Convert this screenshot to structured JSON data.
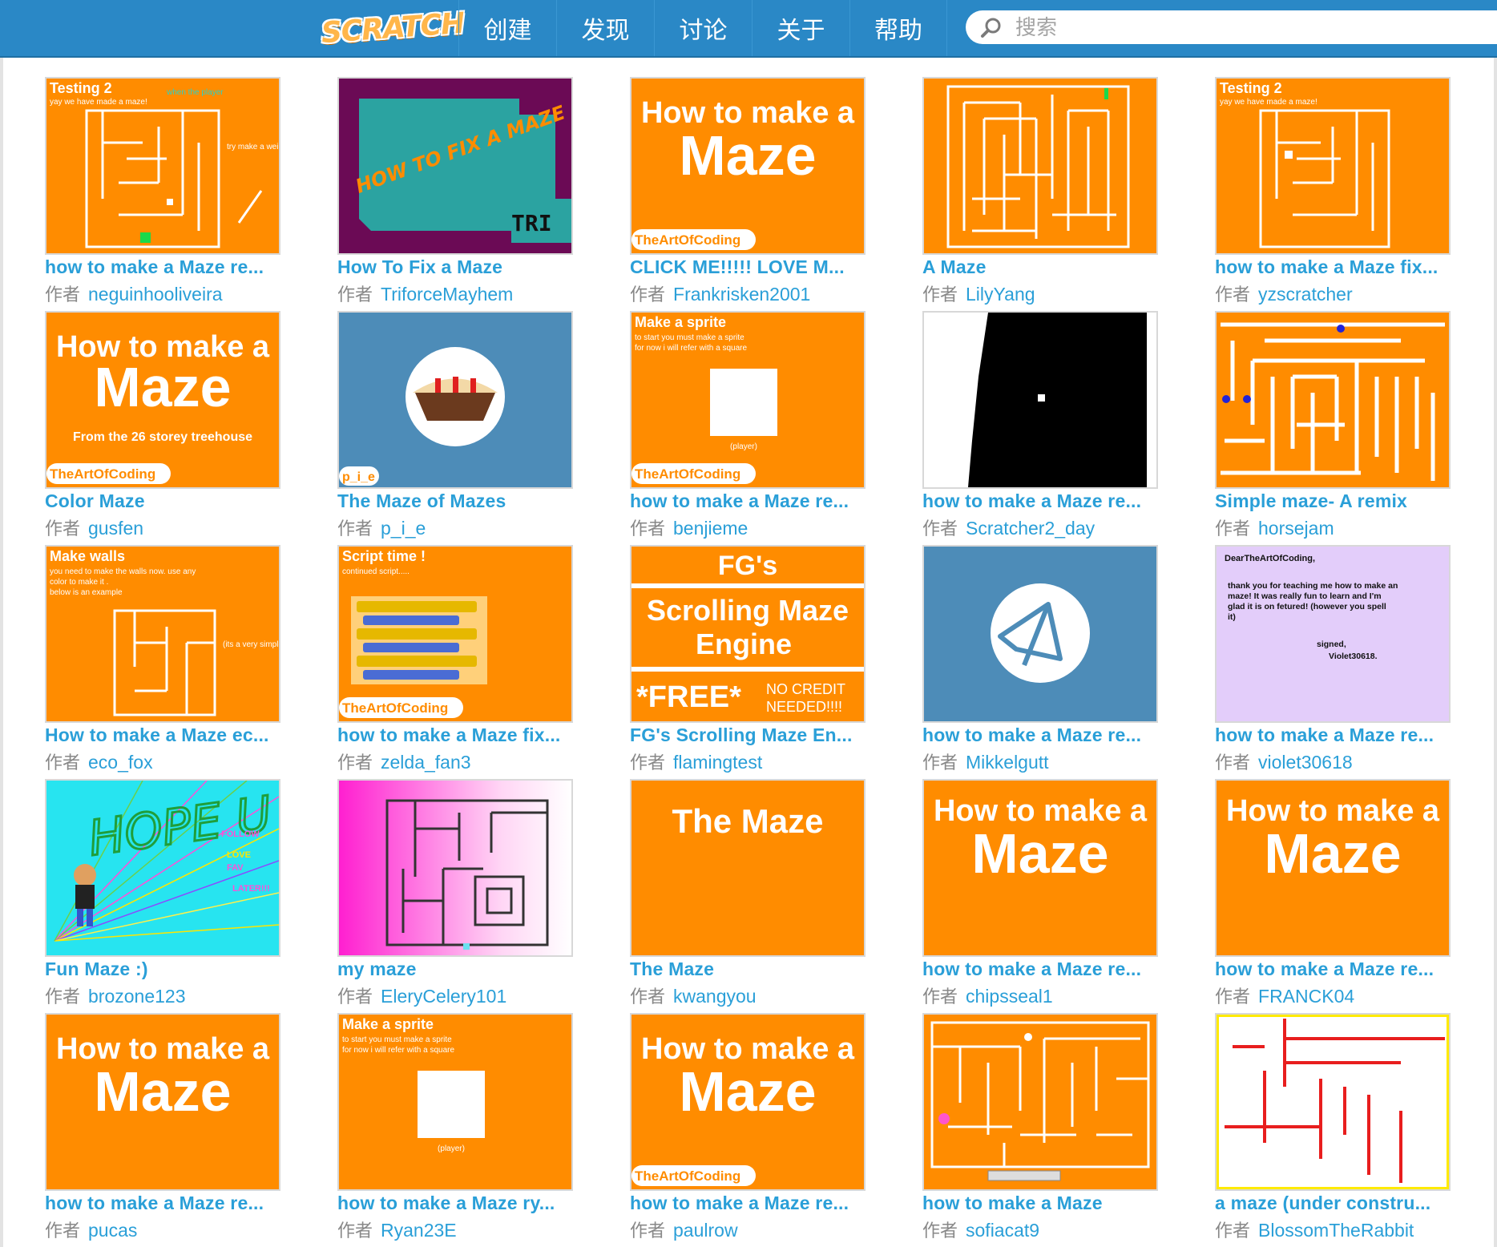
{
  "header": {
    "logo": "SCRATCH",
    "nav": [
      "创建",
      "发现",
      "讨论",
      "关于",
      "帮助"
    ],
    "search_placeholder": "搜索"
  },
  "by_label": "作者",
  "colors": {
    "nav_bg": "#2a88c6",
    "link": "#2a9fd8",
    "thumb_orange": "#ff8c00"
  },
  "projects": [
    {
      "title": "how to make a Maze re...",
      "author": "neguinhooliveira"
    },
    {
      "title": "How To Fix a Maze",
      "author": "TriforceMayhem"
    },
    {
      "title": "CLICK ME!!!!! LOVE M...",
      "author": "Frankrisken2001"
    },
    {
      "title": "A Maze",
      "author": "LilyYang"
    },
    {
      "title": "how to make a Maze fix...",
      "author": "yzscratcher"
    },
    {
      "title": "Color Maze",
      "author": "gusfen"
    },
    {
      "title": "The Maze of Mazes",
      "author": "p_i_e"
    },
    {
      "title": "how to make a Maze re...",
      "author": "benjieme"
    },
    {
      "title": "how to make a Maze re...",
      "author": "Scratcher2_day"
    },
    {
      "title": "Simple maze- A remix",
      "author": "horsejam"
    },
    {
      "title": "How to make a Maze ec...",
      "author": "eco_fox"
    },
    {
      "title": "how to make a Maze fix...",
      "author": "zelda_fan3"
    },
    {
      "title": "FG's Scrolling Maze En...",
      "author": "flamingtest"
    },
    {
      "title": "how to make a Maze re...",
      "author": "Mikkelgutt"
    },
    {
      "title": "how to make a Maze re...",
      "author": "violet30618"
    },
    {
      "title": "Fun Maze :)",
      "author": "brozone123"
    },
    {
      "title": "my maze",
      "author": "EleryCelery101"
    },
    {
      "title": "The Maze",
      "author": "kwangyou"
    },
    {
      "title": "how to make a Maze re...",
      "author": "chipsseal1"
    },
    {
      "title": "how to make a Maze re...",
      "author": "FRANCK04"
    },
    {
      "title": "how to make a Maze re...",
      "author": "pucas"
    },
    {
      "title": "how to make a Maze ry...",
      "author": "Ryan23E"
    },
    {
      "title": "how to make a Maze re...",
      "author": "paulrow"
    },
    {
      "title": "how to make a Maze",
      "author": "sofiacat9"
    },
    {
      "title": "a maze (under constru...",
      "author": "BlossomTheRabbit"
    }
  ],
  "thumb_text": {
    "testing2": "Testing 2",
    "yay": "yay we have made a maze!",
    "when_player": "when the player",
    "try_weirdy": "try make a weirdy",
    "howto1": "How to make a",
    "howto2": "Maze",
    "artofcoding": "TheArtOfCoding",
    "treehouse": "From the 26 storey treehouse",
    "fix_maze": "HOW TO FIX A MAZE",
    "tri": "TRI",
    "pie": "p_i_e",
    "make_sprite": "Make a sprite",
    "sprite_sub1": "to start you must make a sprite",
    "sprite_sub2": "for now i will refer with a square",
    "player": "(player)",
    "make_walls": "Make walls",
    "walls_sub1": "you need to make the walls now. use any",
    "walls_sub2": "color to make it .",
    "walls_sub3": "below is an example",
    "walls_note": "(its a very simple maze wall)",
    "script_time": "Script time !",
    "continued": "continued script.....",
    "fg1": "FG's",
    "fg2": "Scrolling Maze",
    "fg3": "Engine",
    "free": "*FREE*",
    "nocredit1": "NO CREDIT",
    "nocredit2": "NEEDED!!!!",
    "dear": "DearTheArtOfCoding,",
    "letter1": "thank you for teaching me how to make an",
    "letter2": "maze! It was really fun to learn and I'm",
    "letter3": "glad it is on fetured! (however you spell",
    "letter4": "it)",
    "signed": "signed,",
    "violet": "Violet30618.",
    "hope": "HOPE U LIKED IT",
    "follow": "FOLLOW",
    "love": "LOVE",
    "fav": "FAV",
    "later": "LATER!!!",
    "the_maze": "The Maze"
  }
}
